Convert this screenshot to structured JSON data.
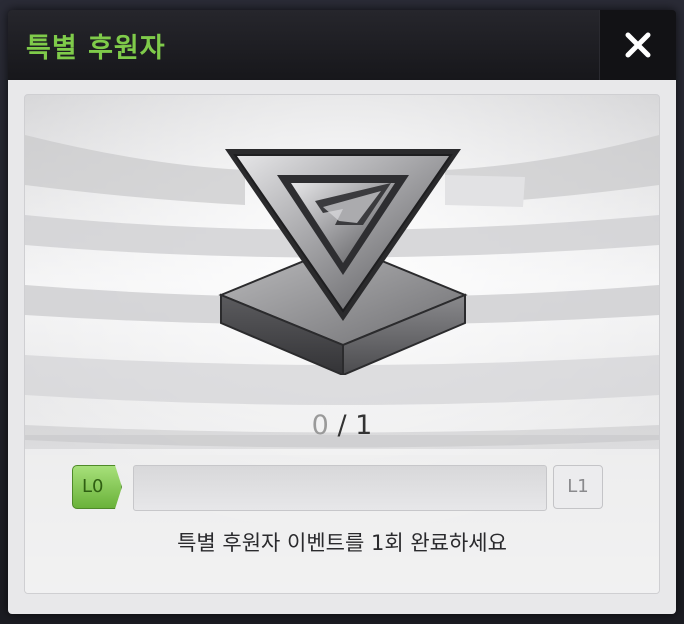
{
  "dialog": {
    "title": "특별 후원자",
    "close_icon": "close-icon"
  },
  "colors": {
    "title_green": "#7fcb4a",
    "level_green": "#7fcb4a"
  },
  "progress": {
    "current": "0",
    "separator": " / ",
    "total": "1",
    "fraction": 0
  },
  "levels": {
    "start": "L0",
    "end": "L1"
  },
  "mission": {
    "text": "특별 후원자 이벤트를 1회 완료하세요"
  },
  "icons": {
    "trophy": "silver-trophy-icon"
  }
}
